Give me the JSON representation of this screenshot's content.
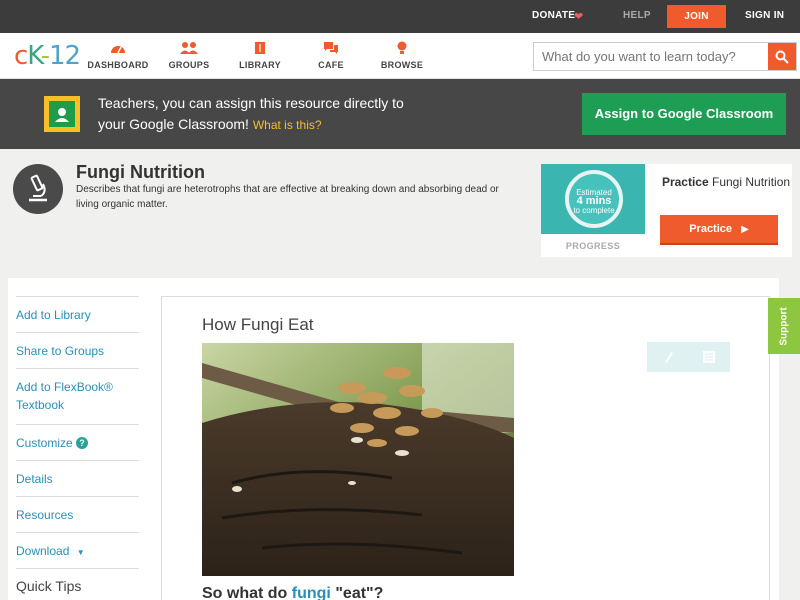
{
  "topbar": {
    "donate": "DONATE",
    "help": "HELP",
    "join": "JOIN",
    "signin": "SIGN IN"
  },
  "nav": {
    "logo": {
      "c": "c",
      "k": "K",
      "dash": "-",
      "num": "12"
    },
    "items": [
      {
        "label": "DASHBOARD",
        "icon": "dashboard-icon"
      },
      {
        "label": "GROUPS",
        "icon": "groups-icon"
      },
      {
        "label": "LIBRARY",
        "icon": "library-icon"
      },
      {
        "label": "CAFE",
        "icon": "cafe-icon"
      },
      {
        "label": "BROWSE",
        "icon": "browse-icon"
      }
    ],
    "search_placeholder": "What do you want to learn today?"
  },
  "banner": {
    "line1": "Teachers, you can assign this resource directly to",
    "line2": "your Google Classroom!",
    "what": "What is this?",
    "assign": "Assign to Google Classroom"
  },
  "concept": {
    "title": "Fungi Nutrition",
    "description": "Describes that fungi are heterotrophs that are effective at breaking down and absorbing dead or living organic matter."
  },
  "practice": {
    "estimated": "Estimated",
    "mins": "4 mins",
    "to_complete": "to complete",
    "progress": "PROGRESS",
    "title_bold": "Practice",
    "title_rest": "Fungi Nutrition",
    "button": "Practice"
  },
  "sidebar": {
    "items": [
      "Add to Library",
      "Share to Groups",
      "Add to FlexBook®",
      "Textbook",
      "Customize",
      "Details",
      "Resources",
      "Download",
      "Quick Tips"
    ]
  },
  "article": {
    "title": "How Fungi Eat",
    "sub_pre": "So what do",
    "sub_hl": "fungi",
    "sub_post": "\"eat\"?"
  },
  "support": "Support",
  "colors": {
    "accent": "#ef5b2c",
    "green": "#1e9e55",
    "link": "#2a8fb5",
    "teal": "#3ab5b0"
  }
}
